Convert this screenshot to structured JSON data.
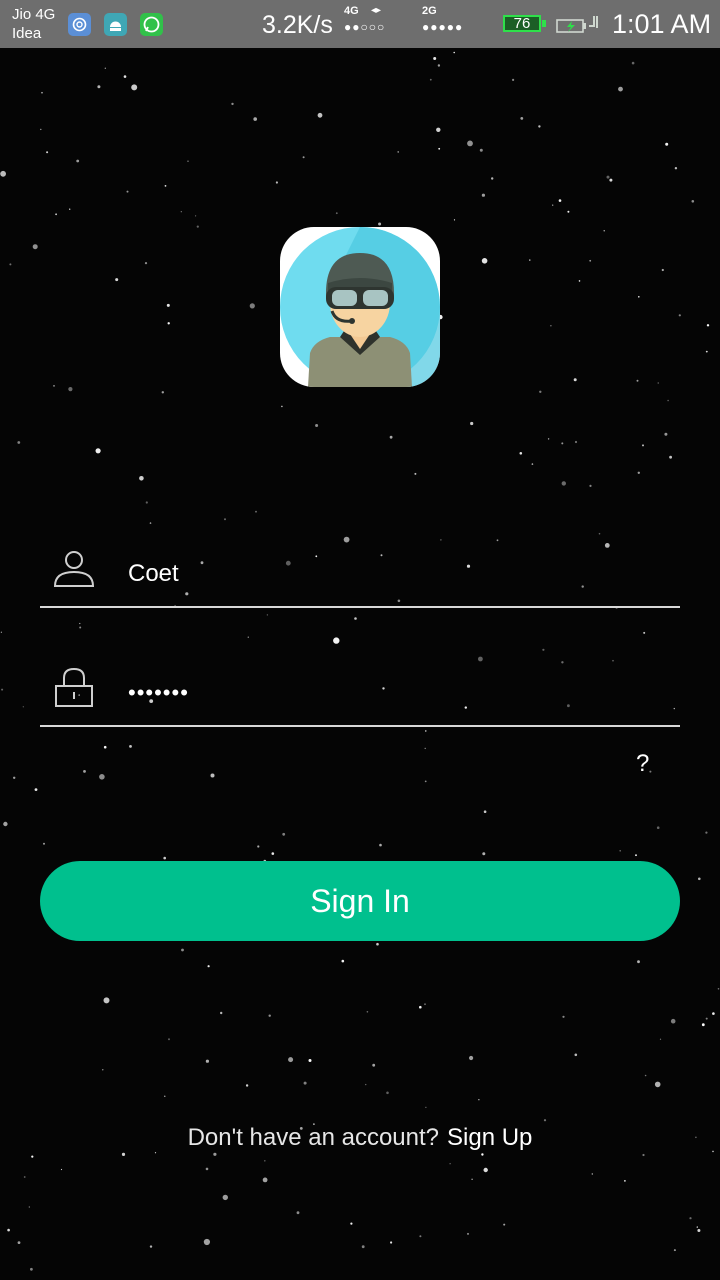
{
  "status_bar": {
    "carrier_1": "Jio 4G",
    "carrier_2": "Idea",
    "net_speed": "3.2K/s",
    "sim1_label": "4G",
    "sim1_dots": "●●○○○",
    "sim2_label": "2G",
    "sim2_dots": "●●●●●",
    "battery_level": "76",
    "time": "1:01 AM",
    "app_icons": [
      "sync-app-icon",
      "android-app-icon",
      "whatsapp-icon"
    ]
  },
  "login": {
    "username_value": "Coet",
    "password_dots": "•••••••",
    "help_label": "?",
    "signin_label": "Sign In",
    "footer_prompt": "Don't have an account?",
    "signup_label": "Sign Up"
  },
  "colors": {
    "background": "#050505",
    "accent": "#00c08e",
    "status_bar": "#6e6e6e",
    "avatar_bg": "#5fd2e8"
  }
}
